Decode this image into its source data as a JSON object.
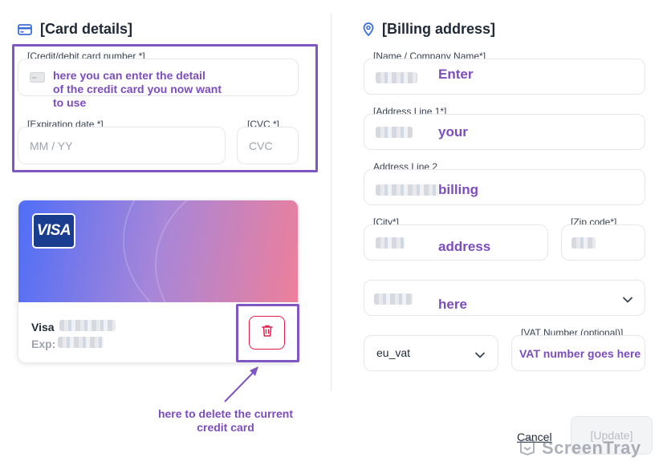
{
  "card_details": {
    "title": "[Card details]",
    "card_number_label": "[Credit/debit card number *]",
    "card_number_note": [
      "here you can enter the detail",
      "of the credit card you now want",
      "to use"
    ],
    "expiration_label": "[Expiration date *]",
    "expiration_placeholder": "MM / YY",
    "cvc_label": "[CVC *]",
    "cvc_placeholder": "CVC"
  },
  "saved_card": {
    "brand_logo": "VISA",
    "brand": "Visa",
    "exp_label": "Exp:",
    "delete_note": [
      "here to delete the current",
      "credit card"
    ],
    "icons": {
      "trash": "trash-icon",
      "logo": "visa-logo"
    }
  },
  "billing_address": {
    "title": "[Billing address]",
    "name_label": "[Name / Company Name*]",
    "name_note": "Enter",
    "address1_label": "[Address Line 1*]",
    "address1_note": "your",
    "address2_label": "Address Line 2",
    "address2_note": "billing",
    "city_label": "[City*]",
    "city_note": "address",
    "zip_label": "[Zip code*]",
    "country_note": "here",
    "vat_type_value": "eu_vat",
    "vat_number_label": "[VAT Number (optional)]",
    "vat_number_note": "VAT number goes here"
  },
  "footer": {
    "cancel_label": "Cancel",
    "update_label": "[Update]",
    "watermark": "ScreenTray"
  },
  "colors": {
    "annotation": "#7c4dbd",
    "highlight_border": "#7e57c2",
    "delete_red": "#e11d48",
    "location_pin": "#3b6fd8"
  }
}
